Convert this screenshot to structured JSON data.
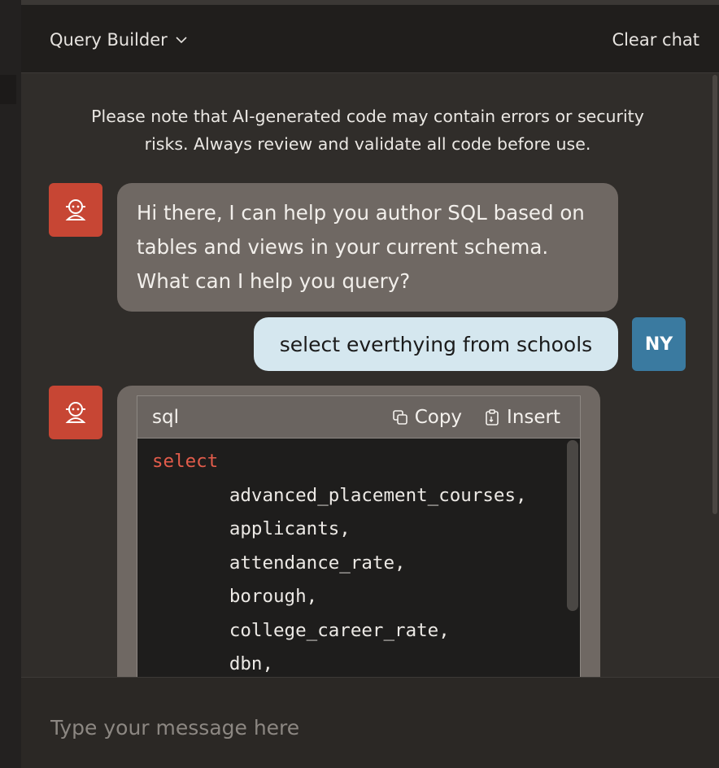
{
  "header": {
    "title": "Query Builder",
    "clear_label": "Clear chat"
  },
  "notice": "Please note that AI-generated code may contain errors or security risks. Always review and validate all code before use.",
  "messages": {
    "bot_greeting": "Hi there, I can help you author SQL based on tables and views in your current schema. What can I help you query?",
    "user_query": "select everthying from schools",
    "user_initials": "NY"
  },
  "code_block": {
    "language": "sql",
    "copy_label": "Copy",
    "insert_label": "Insert",
    "keyword": "select",
    "columns": [
      "advanced_placement_courses,",
      "applicants,",
      "attendance_rate,",
      "borough,",
      "college_career_rate,",
      "dbn,"
    ]
  },
  "composer": {
    "placeholder": "Type your message here"
  },
  "colors": {
    "bot_avatar": "#c74634",
    "user_avatar": "#3a7aa0",
    "user_bubble": "#d5e7ef",
    "bot_bubble": "#6f6863",
    "sql_keyword": "#e25c4b"
  },
  "icons": {
    "bot_avatar": "robot-icon",
    "title_dropdown": "chevron-down-icon",
    "copy": "copy-icon",
    "insert": "clipboard-icon"
  }
}
